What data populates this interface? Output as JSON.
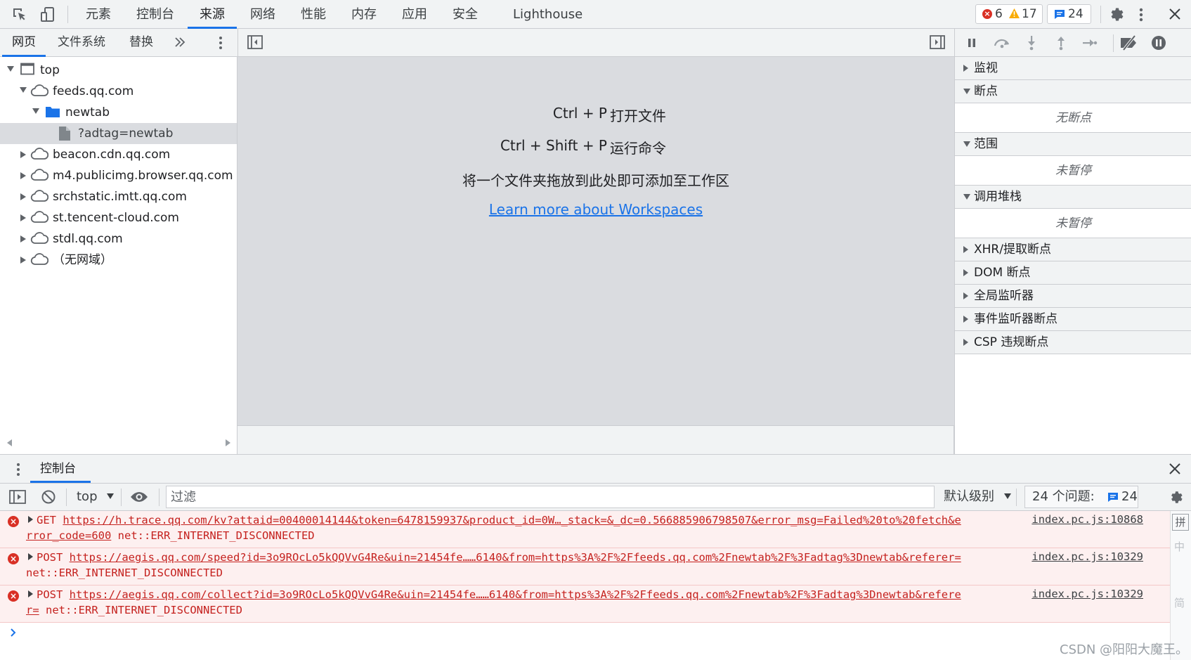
{
  "top_tabs": [
    "元素",
    "控制台",
    "来源",
    "网络",
    "性能",
    "内存",
    "应用",
    "安全",
    "Lighthouse"
  ],
  "active_top_tab": "来源",
  "badges": {
    "errors": "6",
    "warnings": "17",
    "messages": "24"
  },
  "sub_tabs": [
    "网页",
    "文件系统",
    "替换"
  ],
  "tree": [
    {
      "label": "top",
      "icon": "frame-icon",
      "expanded": true
    },
    {
      "label": "feeds.qq.com",
      "icon": "cloud-icon",
      "expanded": true
    },
    {
      "label": "newtab",
      "icon": "folder-icon",
      "expanded": true
    },
    {
      "label": "?adtag=newtab",
      "icon": "file-icon",
      "selected": true
    },
    {
      "label": "beacon.cdn.qq.com",
      "icon": "cloud-icon"
    },
    {
      "label": "m4.publicimg.browser.qq.com",
      "icon": "cloud-icon"
    },
    {
      "label": "srchstatic.imtt.qq.com",
      "icon": "cloud-icon"
    },
    {
      "label": "st.tencent-cloud.com",
      "icon": "cloud-icon"
    },
    {
      "label": "stdl.qq.com",
      "icon": "cloud-icon"
    },
    {
      "label": "（无网域）",
      "icon": "cloud-icon"
    }
  ],
  "editor": {
    "shortcut1_keys": "Ctrl + P",
    "shortcut1_action": "打开文件",
    "shortcut2_keys": "Ctrl + Shift + P",
    "shortcut2_action": "运行命令",
    "drop_hint": "将一个文件夹拖放到此处即可添加至工作区",
    "learn_more": "Learn more about Workspaces"
  },
  "debugger_sections": {
    "watch": "监视",
    "breakpoints": "断点",
    "breakpoints_empty": "无断点",
    "scope": "范围",
    "scope_empty": "未暂停",
    "callstack": "调用堆栈",
    "callstack_empty": "未暂停",
    "xhr": "XHR/提取断点",
    "dom": "DOM 断点",
    "global": "全局监听器",
    "event": "事件监听器断点",
    "csp": "CSP 违规断点"
  },
  "drawer": {
    "tab": "控制台"
  },
  "console_toolbar": {
    "context": "top",
    "filter_placeholder": "过滤",
    "level": "默认级别",
    "issues_label": "24 个问题:",
    "issues_count": "24"
  },
  "messages": [
    {
      "method": "GET",
      "url_line1": "https://h.trace.qq.com/kv?attaid=00400014144&token=6478159937&product_id=0W…_stack=&_dc=0.566885906798507&error_msg=Failed%20to%20fetch&e",
      "url_line2": "rror_code=600",
      "error": "net::ERR_INTERNET_DISCONNECTED",
      "source": "index.pc.js:10868"
    },
    {
      "method": "POST",
      "url_line1": "https://aegis.qq.com/speed?id=3o9ROcLo5kQQVvG4Re&uin=21454fe……6140&from=https%3A%2F%2Ffeeds.qq.com%2Fnewtab%2F%3Fadtag%3Dnewtab&referer=",
      "url_line2": "",
      "error": "net::ERR_INTERNET_DISCONNECTED",
      "source": "index.pc.js:10329"
    },
    {
      "method": "POST",
      "url_line1": "https://aegis.qq.com/collect?id=3o9ROcLo5kQQVvG4Re&uin=21454fe……6140&from=https%3A%2F%2Ffeeds.qq.com%2Fnewtab%2F%3Fadtag%3Dnewtab&refere",
      "url_line2": "r=",
      "error": "net::ERR_INTERNET_DISCONNECTED",
      "source": "index.pc.js:10329"
    }
  ],
  "side_ime": [
    "拼",
    "中",
    "简"
  ],
  "watermark": "CSDN @阳阳大魔王。"
}
